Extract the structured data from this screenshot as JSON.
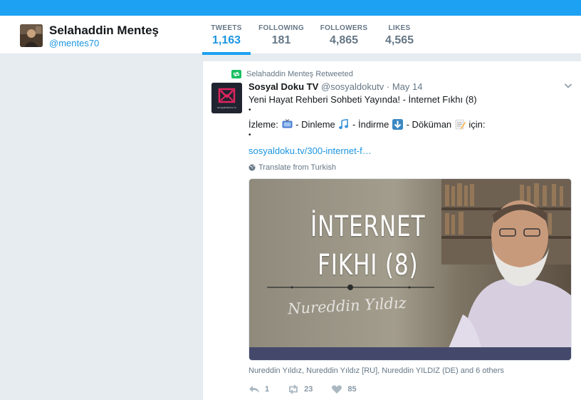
{
  "profile": {
    "name": "Selahaddin Menteş",
    "handle": "@mentes70"
  },
  "stats": [
    {
      "label": "TWEETS",
      "value": "1,163",
      "active": true
    },
    {
      "label": "FOLLOWING",
      "value": "181",
      "active": false
    },
    {
      "label": "FOLLOWERS",
      "value": "4,865",
      "active": false
    },
    {
      "label": "LIKES",
      "value": "4,565",
      "active": false
    }
  ],
  "tweet": {
    "retweet_context": "Selahaddin Menteş Retweeted",
    "author_name": "Sosyal Doku TV",
    "author_handle": "@sosyaldokutv",
    "separator": "·",
    "time": "May 14",
    "avatar_brand": "sosyaldoku.tv",
    "text_line_1": "Yeni Hayat Rehberi Sohbeti Yayında! - İnternet Fıkhı (8)",
    "bullet": "•",
    "izleme": "İzleme:",
    "dinleme": "- Dinleme",
    "indirme": "- İndirme",
    "dokuman": "- Döküman",
    "icin": "için:",
    "link": "sosyaldoku.tv/300-internet-f…",
    "translate": "Translate from Turkish",
    "media": {
      "title_line_1": "İNTERNET",
      "title_line_2": "FIKHI (8)",
      "signature": "Nureddin Yıldız"
    },
    "media_credits": "Nureddin Yıldız, Nureddin Yıldız [RU], Nureddin YILDIZ (DE) and 6 others",
    "actions": {
      "replies": "1",
      "retweets": "23",
      "likes": "85"
    }
  },
  "colors": {
    "brand_blue": "#1da1f2",
    "link_blue": "#1b95e0",
    "retweet_green": "#17bf63",
    "muted_gray": "#657786"
  },
  "icons": [
    "retweet-icon",
    "caret-down-icon",
    "globe-icon",
    "tv-emoji-icon",
    "music-notes-emoji-icon",
    "down-arrow-emoji-icon",
    "memo-emoji-icon",
    "reply-icon",
    "like-icon"
  ]
}
